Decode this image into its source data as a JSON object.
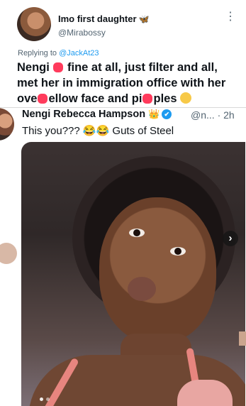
{
  "tweet": {
    "author_name": "Imo first daughter",
    "author_handle": "@Mirabossy",
    "name_decoration_icon": "butterfly-emoji",
    "replying_to_label": "Replying to ",
    "replying_to_handle": "@JackAt23",
    "text_part1": "Nengi ",
    "text_part2": " fine at all, just filter and all, met her in immigration office with her ove",
    "text_part3": "ellow face and pi",
    "text_part4": "ples ",
    "end_emoji": "grimacing-emoji"
  },
  "quoted": {
    "author_name": "Nengi Rebecca Hampson",
    "crown_icon": "crown-emoji",
    "verified_icon": "verified-badge-icon",
    "handle_truncated": "@n...",
    "dot": "·",
    "time": "2h",
    "text_part1": "This you??? ",
    "laugh_emoji": "😂😂",
    "text_part2": " Guts of Steel",
    "carousel_next": "›"
  },
  "colors": {
    "accent": "#1d9bf0",
    "text": "#0f1419",
    "secondary": "#536471",
    "redaction": "#ff3b5c"
  }
}
